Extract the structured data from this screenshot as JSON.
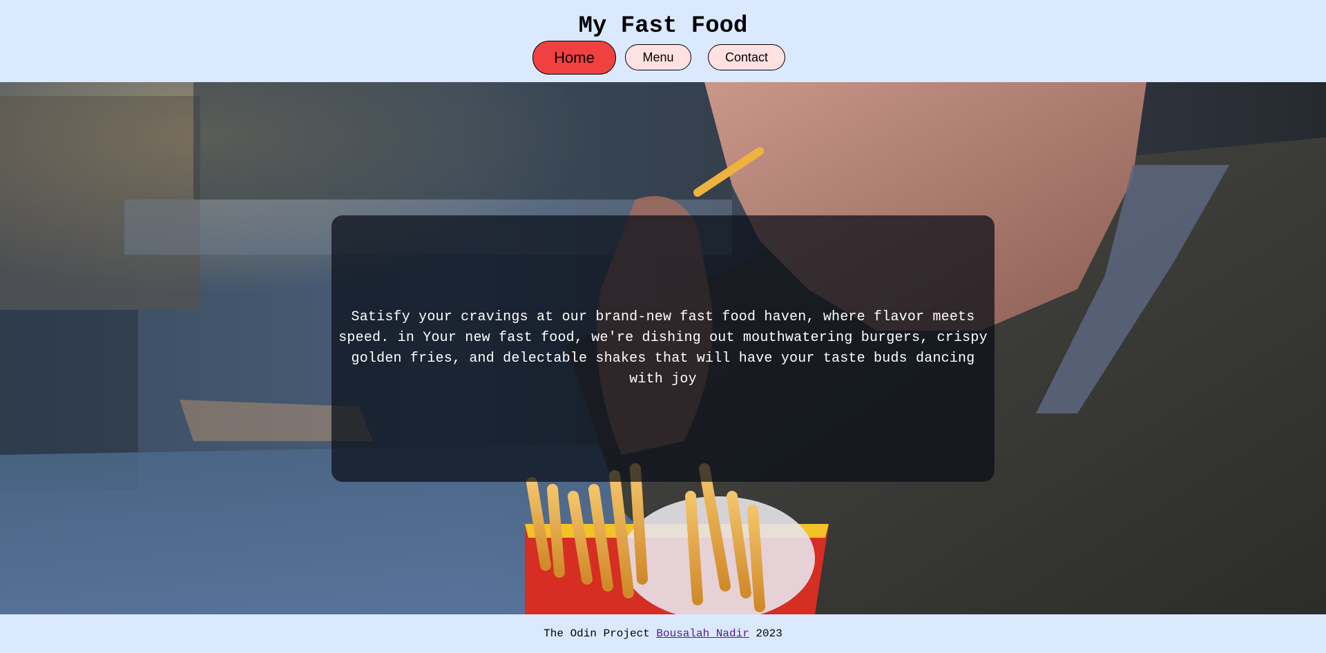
{
  "header": {
    "title": "My Fast Food",
    "nav": [
      {
        "label": "Home",
        "active": true
      },
      {
        "label": "Menu",
        "active": false
      },
      {
        "label": "Contact",
        "active": false
      }
    ]
  },
  "hero": {
    "image": "woman-eating-french-fries-photo",
    "text": "Satisfy your cravings at our brand-new fast food haven, where flavor meets speed. in Your new fast food, we're dishing out mouthwatering burgers, crispy golden fries, and delectable shakes that will have your taste buds dancing with joy"
  },
  "footer": {
    "prefix": "The Odin Project",
    "author_link": "Bousalah Nadir",
    "year": "2023"
  },
  "colors": {
    "background": "#dbe9ff",
    "active_nav": "#f04040",
    "inactive_nav": "#ffe1e1",
    "link": "#551a8b"
  }
}
